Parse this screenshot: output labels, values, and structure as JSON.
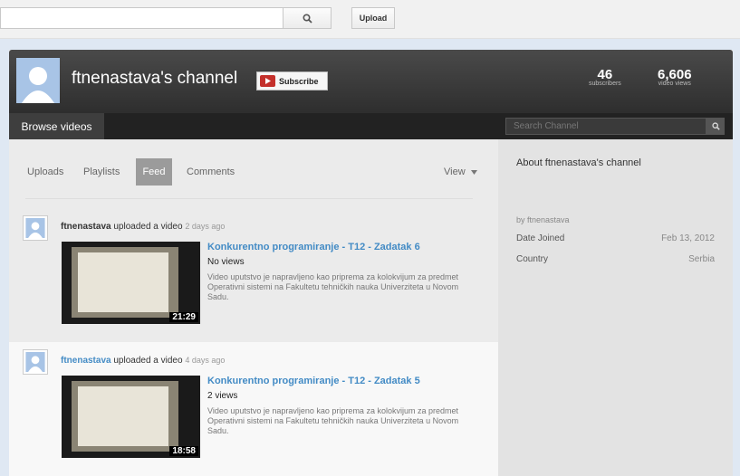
{
  "topbar": {
    "upload_label": "Upload"
  },
  "channel": {
    "title": "ftnenastava's channel",
    "subscribe_label": "Subscribe",
    "stats": [
      {
        "value": "46",
        "label": "subscribers"
      },
      {
        "value": "6,606",
        "label": "video views"
      }
    ]
  },
  "nav": {
    "browse_label": "Browse videos",
    "search_placeholder": "Search Channel"
  },
  "tabs": {
    "uploads": "Uploads",
    "playlists": "Playlists",
    "feed": "Feed",
    "comments": "Comments",
    "view": "View"
  },
  "feed": [
    {
      "user": "ftnenastava",
      "action": "uploaded a video",
      "time": "2 days ago",
      "title": "Konkurentno programiranje - T12 - Zadatak 6",
      "views": "No views",
      "description": "Video uputstvo je napravljeno kao priprema za kolokvijum za predmet Operativni sistemi na Fakultetu tehničkih nauka Univerziteta u Novom Sadu.",
      "duration": "21:29"
    },
    {
      "user": "ftnenastava",
      "action": "uploaded a video",
      "time": "4 days ago",
      "title": "Konkurentno programiranje - T12 - Zadatak 5",
      "views": "2 views",
      "description": "Video uputstvo je napravljeno kao priprema za kolokvijum za predmet Operativni sistemi na Fakultetu tehničkih nauka Univerziteta u Novom Sadu.",
      "duration": "18:58"
    }
  ],
  "about": {
    "title": "About ftnenastava's channel",
    "by": "by ftnenastava",
    "rows": [
      {
        "label": "Date Joined",
        "value": "Feb 13, 2012"
      },
      {
        "label": "Country",
        "value": "Serbia"
      }
    ]
  }
}
